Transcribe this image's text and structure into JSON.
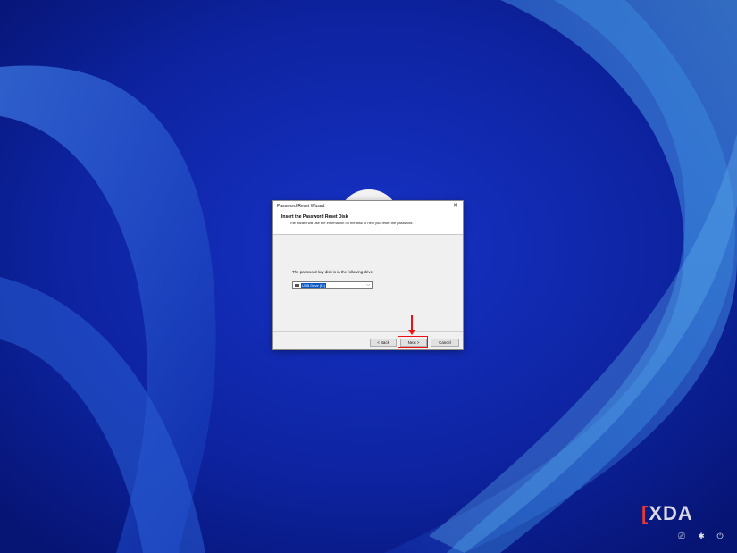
{
  "dialog": {
    "window_title": "Password Reset Wizard",
    "header_title": "Insert the Password Reset Disk",
    "header_subtitle": "The wizard will use the information on the disk to help you reset the password.",
    "drive_label": "The password key disk is in the following drive:",
    "drive_select_value": "USB Drive (E:)",
    "back_label": "< Back",
    "next_label": "Next >",
    "cancel_label": "Cancel"
  },
  "watermark": {
    "brand_text": "XDA"
  },
  "icons": {
    "close": "close-icon",
    "drive": "usb-drive-icon",
    "dropdown": "chevron-down-icon",
    "accessibility": "accessibility-icon",
    "network": "network-icon",
    "power": "power-icon"
  },
  "colors": {
    "wallpaper": "#0a1f8c",
    "highlight": "#ee1111",
    "selection": "#0a58c8"
  }
}
